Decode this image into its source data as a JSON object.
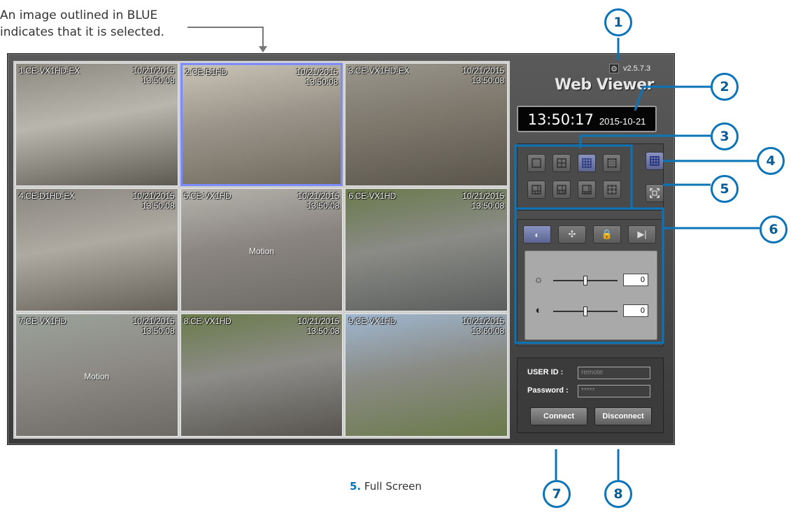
{
  "annotation": {
    "line1": "An image outlined in BLUE",
    "line2": "indicates that it is selected."
  },
  "cameras": [
    {
      "name": "1.CE-VX1HD-EX",
      "date": "10/21/2015",
      "time": "13:50:08",
      "motion": "",
      "selected": false,
      "colors": [
        "#8c8a80",
        "#b9b6ad",
        "#5d5a52"
      ]
    },
    {
      "name": "2.CE-B1HD",
      "date": "10/21/2015",
      "time": "13:50:08",
      "motion": "",
      "selected": true,
      "colors": [
        "#c9c4b6",
        "#9a948a",
        "#706a5e"
      ]
    },
    {
      "name": "3.CE-VX1HD-EX",
      "date": "10/21/2015",
      "time": "13:50:08",
      "motion": "",
      "selected": false,
      "colors": [
        "#9a968c",
        "#7d776c",
        "#5a554c"
      ]
    },
    {
      "name": "4.CE-D1HD-EX",
      "date": "10/21/2015",
      "time": "13:50:08",
      "motion": "",
      "selected": false,
      "colors": [
        "#8a8780",
        "#aeaaa2",
        "#666259"
      ]
    },
    {
      "name": "5.CE-VX1HD",
      "date": "10/21/2015",
      "time": "13:50:08",
      "motion": "Motion",
      "selected": false,
      "colors": [
        "#b6b3ad",
        "#8a8580",
        "#6d6a66"
      ]
    },
    {
      "name": "6.CE-VX1HD",
      "date": "10/21/2015",
      "time": "13:50:08",
      "motion": "",
      "selected": false,
      "colors": [
        "#6a7a4d",
        "#8a8b86",
        "#5b5e5d"
      ]
    },
    {
      "name": "7.CE-VX1HD",
      "date": "10/21/2015",
      "time": "13:50:08",
      "motion": "Motion",
      "selected": false,
      "colors": [
        "#9aa29a",
        "#8e8b86",
        "#6d6a66"
      ]
    },
    {
      "name": "8.CE-VX1HD",
      "date": "10/21/2015",
      "time": "13:50:08",
      "motion": "",
      "selected": false,
      "colors": [
        "#6a7b4b",
        "#8d8c88",
        "#57544f"
      ]
    },
    {
      "name": "9.CE-VX1HD",
      "date": "10/21/2015",
      "time": "13:60:08",
      "motion": "",
      "selected": false,
      "colors": [
        "#9fb7d0",
        "#8a8b85",
        "#6b7a4a"
      ]
    }
  ],
  "panel": {
    "version": "v2.5.7.3",
    "gear_icon": "gear-icon",
    "title": "Web Viewer",
    "clock_time": "13:50:17",
    "clock_date": "2015-10-21",
    "layout_buttons": [
      {
        "icon": "layout-1x1-icon",
        "on": false
      },
      {
        "icon": "layout-2x2-icon",
        "on": false
      },
      {
        "icon": "layout-3x3-icon",
        "on": true
      },
      {
        "icon": "layout-4x4-icon",
        "on": false
      },
      {
        "icon": "layout-1p5-icon",
        "on": false
      },
      {
        "icon": "layout-1p7-icon",
        "on": false
      },
      {
        "icon": "layout-1p12-icon",
        "on": false
      },
      {
        "icon": "layout-2p8-icon",
        "on": false
      }
    ],
    "sequence_icon": "sequence-icon",
    "fullscreen_icon": "fullscreen-icon",
    "ptz_buttons": [
      {
        "icon": "image-adjust-icon",
        "glyph": "◐",
        "on": true
      },
      {
        "icon": "ptz-move-icon",
        "glyph": "✣",
        "on": false
      },
      {
        "icon": "lock-icon",
        "glyph": "🔒",
        "on": false
      },
      {
        "icon": "play-next-icon",
        "glyph": "▶|",
        "on": false
      }
    ],
    "brightness": {
      "icon": "brightness-icon",
      "value": "0",
      "level": 0.5
    },
    "contrast": {
      "icon": "contrast-icon",
      "value": "0",
      "level": 0.5
    },
    "login": {
      "user_label": "USER ID :",
      "user_value": "remote",
      "password_label": "Password :",
      "password_value": "*****",
      "connect": "Connect",
      "disconnect": "Disconnect"
    }
  },
  "callouts": [
    "1",
    "2",
    "3",
    "4",
    "5",
    "6",
    "7",
    "8"
  ],
  "caption": {
    "number": "5.",
    "text": "Full Screen"
  },
  "colors": {
    "callout_blue": "#0b74b8",
    "selected_outline": "#7a8cff",
    "panel_dark": "#3b3b3b"
  }
}
